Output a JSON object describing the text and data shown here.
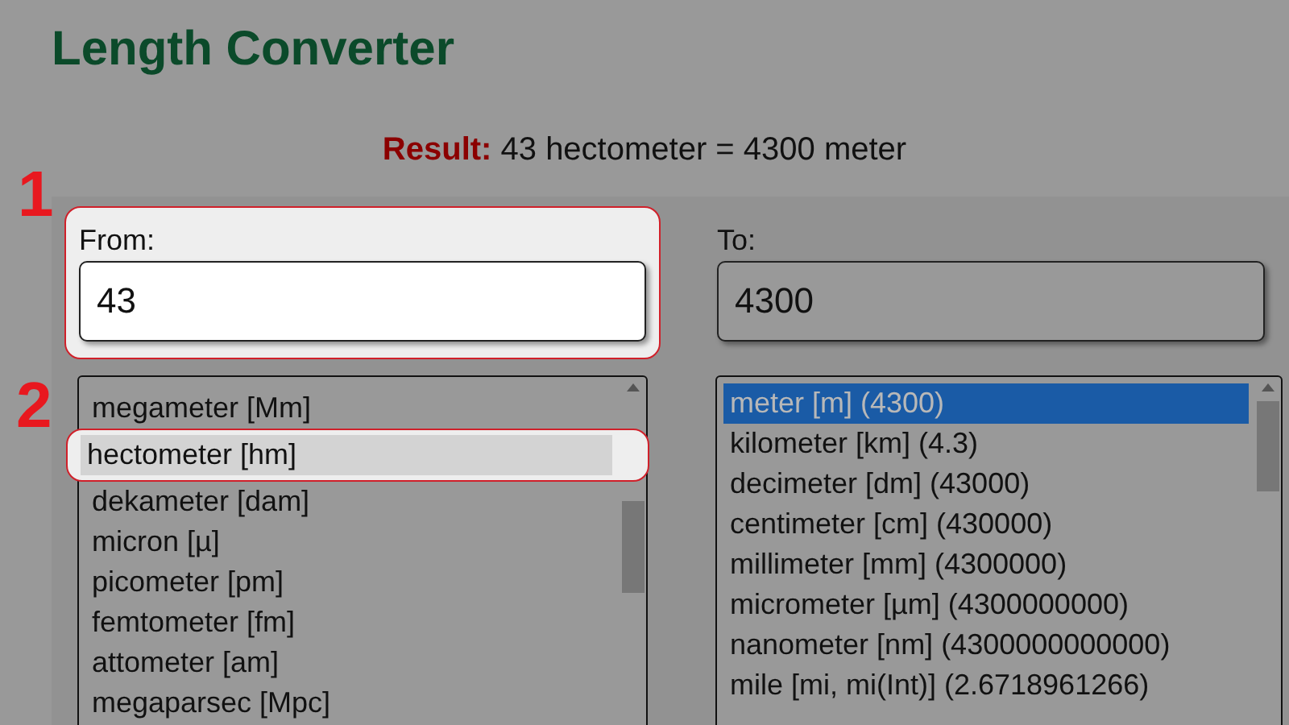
{
  "title": "Length Converter",
  "result": {
    "label": "Result:",
    "text": "43 hectometer = 4300 meter"
  },
  "from": {
    "label": "From:",
    "value": "43",
    "callout": "1"
  },
  "to": {
    "label": "To:",
    "value": "4300"
  },
  "from_units": [
    {
      "label": "megameter [Mm]",
      "selected": false
    },
    {
      "label": "hectometer [hm]",
      "selected": true,
      "callout": "2"
    },
    {
      "label": "dekameter [dam]",
      "selected": false
    },
    {
      "label": "micron [µ]",
      "selected": false
    },
    {
      "label": "picometer [pm]",
      "selected": false
    },
    {
      "label": "femtometer [fm]",
      "selected": false
    },
    {
      "label": "attometer [am]",
      "selected": false
    },
    {
      "label": "megaparsec [Mpc]",
      "selected": false
    }
  ],
  "to_units": [
    {
      "label": "meter [m] (4300)",
      "selected": true
    },
    {
      "label": "kilometer [km] (4.3)",
      "selected": false
    },
    {
      "label": "decimeter [dm] (43000)",
      "selected": false
    },
    {
      "label": "centimeter [cm] (430000)",
      "selected": false
    },
    {
      "label": "millimeter [mm] (4300000)",
      "selected": false
    },
    {
      "label": "micrometer [µm] (4300000000)",
      "selected": false
    },
    {
      "label": "nanometer [nm] (4300000000000)",
      "selected": false
    },
    {
      "label": "mile [mi, mi(Int)] (2.6718961266)",
      "selected": false
    }
  ]
}
